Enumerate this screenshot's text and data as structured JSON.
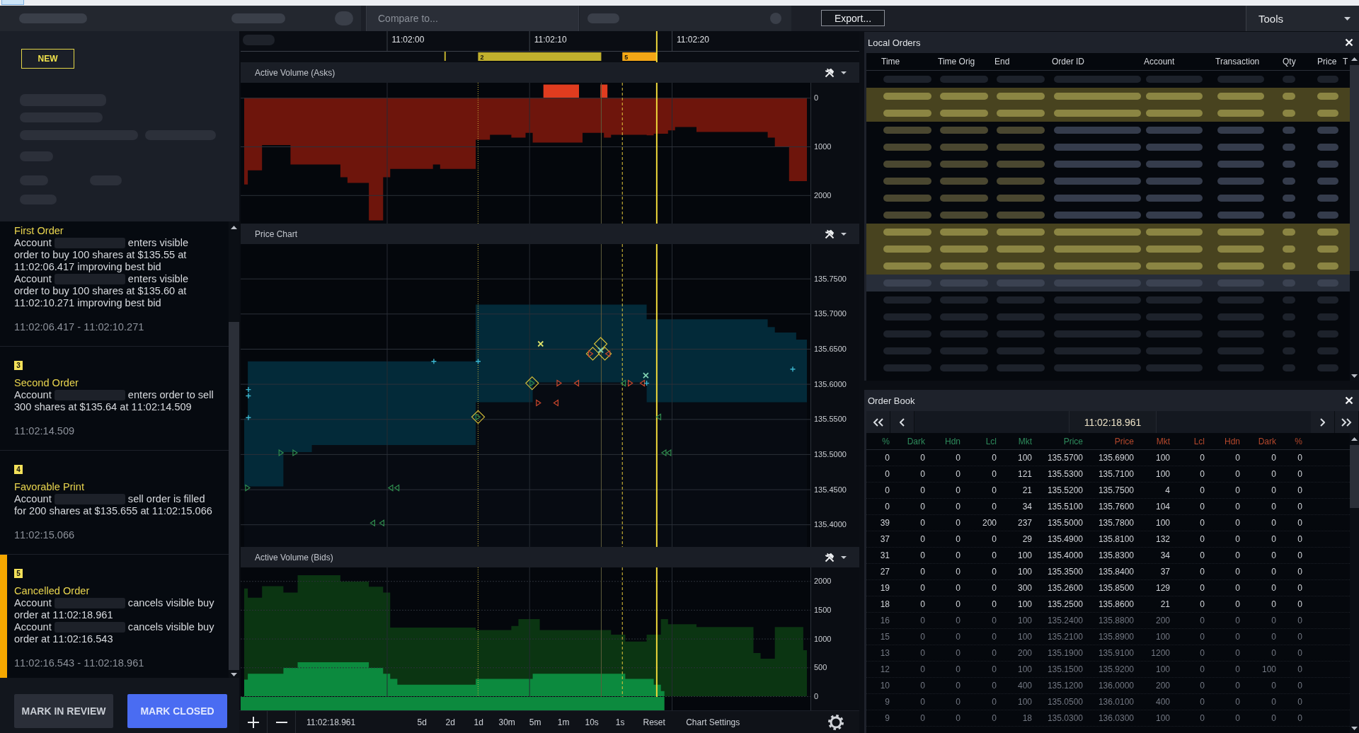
{
  "toolbar": {
    "compare_field": {
      "placeholder": "Compare to..."
    },
    "export_button": "Export...",
    "tools_menu": "Tools"
  },
  "case_panel": {
    "badge": "NEW",
    "events": [
      {
        "title": "First Order",
        "lines": [
          {
            "redacted": true,
            "label": "Account",
            "text": "enters visible order to buy 100 shares at $135.55 at 11:02:06.417 improving best bid"
          },
          {
            "redacted": true,
            "label": "Account",
            "text": "enters visible order to buy 100 shares at $135.60 at 11:02:10.271 improving best bid"
          }
        ],
        "time_range": "11:02:06.417 - 11:02:10.271",
        "selected": false
      },
      {
        "number": "3",
        "title": "Second Order",
        "lines": [
          {
            "redacted": true,
            "label": "Account",
            "text": "enters order to sell 300 shares at $135.64 at 11:02:14.509"
          }
        ],
        "time_range": "11:02:14.509",
        "selected": false
      },
      {
        "number": "4",
        "title": "Favorable Print",
        "lines": [
          {
            "redacted": true,
            "label": "Account",
            "text": "sell order is filled for 200 shares at $135.655 at 11:02:15.066"
          }
        ],
        "time_range": "11:02:15.066",
        "selected": false
      },
      {
        "number": "5",
        "title": "Cancelled Order",
        "lines": [
          {
            "redacted": true,
            "label": "Account",
            "text": "cancels visible buy order at 11:02:18.961"
          },
          {
            "redacted": true,
            "label": "Account",
            "text": "cancels visible buy order at 11:02:16.543"
          }
        ],
        "time_range": "11:02:16.543 - 11:02:18.961",
        "selected": true
      }
    ],
    "actions": [
      {
        "label": "MARK IN REVIEW",
        "kind": "secondary"
      },
      {
        "label": "MARK CLOSED",
        "kind": "primary"
      }
    ]
  },
  "charts": [
    {
      "title": "Active Volume (Asks)",
      "range_markers": [
        {
          "label": "2",
          "color": "#c1b02d"
        },
        {
          "label": "5",
          "color": "#f4a716"
        }
      ],
      "chart_data": {
        "type": "area",
        "grid": true,
        "categories": [
          null,
          null,
          null,
          null,
          null,
          null,
          null,
          null,
          null,
          null,
          null,
          null,
          null,
          null,
          null,
          null,
          null,
          null,
          null,
          null,
          null,
          null,
          null,
          "11:02:00",
          null,
          null,
          null,
          null,
          null,
          null,
          null,
          null,
          null,
          null,
          null,
          null,
          null,
          null,
          null,
          null,
          null,
          null,
          null,
          "11:02:10",
          null,
          null,
          null,
          null,
          null,
          null,
          null,
          null,
          null,
          null,
          null,
          null,
          null,
          null,
          null,
          null,
          null,
          null,
          null,
          "11:02:20",
          null,
          null,
          null,
          null,
          null,
          null,
          null,
          null,
          null,
          null,
          null,
          null,
          null,
          null,
          null,
          null
        ],
        "series": [
          {
            "color": "#6e150c",
            "values": [
              1780,
              1490,
              1490,
              970,
              970,
              970,
              970,
              1370,
              1370,
              1370,
              1370,
              1370,
              1370,
              1370,
              1630,
              1750,
              1750,
              1750,
              2520,
              2520,
              1630,
              1460,
              1460,
              1460,
              1460,
              1460,
              1460,
              1370,
              1460,
              1460,
              1460,
              1460,
              1460,
              860,
              860,
              760,
              760,
              760,
              820,
              820,
              720,
              920,
              920,
              920,
              920,
              920,
              920,
              920,
              720,
              720,
              720,
              820,
              760,
              760,
              760,
              760,
              760,
              770,
              740,
              740,
              670,
              600,
              600,
              600,
              700,
              700,
              700,
              700,
              700,
              700,
              700,
              700,
              700,
              700,
              820,
              1000,
              1000,
              1710,
              1710,
              1710
            ]
          },
          {
            "color": "#e03c1f",
            "values": [
              null,
              null,
              null,
              null,
              null,
              null,
              null,
              null,
              null,
              null,
              null,
              null,
              null,
              null,
              null,
              null,
              null,
              null,
              null,
              null,
              null,
              null,
              null,
              null,
              null,
              null,
              null,
              null,
              null,
              null,
              null,
              null,
              null,
              null,
              null,
              null,
              null,
              null,
              null,
              null,
              null,
              null,
              -270,
              -270,
              -270,
              -270,
              -270,
              -270,
              null,
              null,
              -270,
              -270,
              null,
              null,
              null,
              null,
              null,
              null,
              null,
              null,
              null,
              null,
              null,
              null,
              null,
              null,
              null,
              null,
              null,
              null,
              null,
              null,
              null,
              null,
              null,
              null,
              null,
              null,
              null,
              null
            ]
          }
        ],
        "ylim": [
          2584,
          -308
        ],
        "yticks": [
          0,
          1000,
          2000
        ]
      }
    },
    {
      "title": "Price Chart",
      "chart_data": {
        "type": "area",
        "grid": true,
        "categories": [
          null,
          null,
          null,
          null,
          null,
          null,
          null,
          null,
          null,
          null,
          null,
          null,
          null,
          null,
          null,
          null,
          null,
          null,
          null,
          null,
          null,
          null,
          null,
          null,
          null,
          null,
          null,
          null,
          null,
          null,
          null,
          null,
          null,
          null,
          null,
          null,
          null,
          null,
          null,
          null,
          null,
          null,
          null,
          null,
          null,
          null,
          null,
          null,
          null,
          null,
          null,
          null,
          null,
          null,
          null,
          null,
          null,
          null,
          null,
          null,
          null,
          null,
          null,
          null,
          null,
          null,
          null,
          null,
          null,
          null,
          null,
          null,
          null,
          null,
          null,
          null,
          null,
          null,
          null,
          null
        ],
        "series": [
          {
            "color": "#032a39",
            "values": [
              135.551,
              135.632,
              135.632,
              135.632,
              135.632,
              135.632,
              135.632,
              135.632,
              135.632,
              135.632,
              135.632,
              135.632,
              135.632,
              135.632,
              135.632,
              135.632,
              135.632,
              135.632,
              135.632,
              135.632,
              135.632,
              135.632,
              135.632,
              135.632,
              135.632,
              135.632,
              135.632,
              135.632,
              135.632,
              135.632,
              135.632,
              135.632,
              135.632,
              135.713,
              135.713,
              135.713,
              135.713,
              135.713,
              135.713,
              135.713,
              135.713,
              135.713,
              135.713,
              135.713,
              135.713,
              135.713,
              135.713,
              135.713,
              135.713,
              135.713,
              135.713,
              135.713,
              135.713,
              135.713,
              135.713,
              135.713,
              135.713,
              135.692,
              135.692,
              135.692,
              135.692,
              135.692,
              135.692,
              135.692,
              135.692,
              135.692,
              135.692,
              135.692,
              135.692,
              135.692,
              135.692,
              135.692,
              135.692,
              135.692,
              135.681,
              135.673,
              135.673,
              135.673,
              135.663,
              135.663
            ]
          },
          {
            "color": "#070b12",
            "values": [
              135.454,
              135.454,
              135.454,
              135.454,
              135.454,
              135.454,
              135.503,
              135.503,
              135.503,
              135.503,
              135.513,
              135.513,
              135.513,
              135.513,
              135.513,
              135.513,
              135.513,
              135.513,
              135.513,
              135.513,
              135.513,
              135.513,
              135.513,
              135.513,
              135.513,
              135.513,
              135.513,
              135.513,
              135.513,
              135.513,
              135.513,
              135.513,
              135.513,
              135.574,
              135.574,
              135.574,
              135.574,
              135.574,
              135.574,
              135.574,
              135.574,
              135.602,
              135.602,
              135.602,
              135.602,
              135.602,
              135.602,
              135.602,
              135.602,
              135.602,
              135.602,
              135.602,
              135.602,
              135.602,
              135.602,
              135.602,
              135.602,
              135.574,
              135.574,
              135.574,
              135.574,
              135.574,
              135.574,
              135.574,
              135.574,
              135.574,
              135.574,
              135.574,
              135.574,
              135.574,
              135.574,
              135.574,
              135.574,
              135.574,
              135.574,
              135.574,
              135.574,
              135.574,
              135.574,
              135.574
            ]
          }
        ],
        "ylim": [
          135.368,
          135.799
        ],
        "yticks": [
          {
            "value": 135.4,
            "label": "135.4000"
          },
          {
            "value": 135.45,
            "label": "135.4500"
          },
          {
            "value": 135.5,
            "label": "135.5000"
          },
          {
            "value": 135.55,
            "label": "135.5500"
          },
          {
            "value": 135.6,
            "label": "135.6000"
          },
          {
            "value": 135.65,
            "label": "135.6500"
          },
          {
            "value": 135.7,
            "label": "135.7000"
          },
          {
            "value": 135.75,
            "label": "135.7500"
          }
        ]
      }
    },
    {
      "title": "Active Volume (Bids)",
      "chart_data": {
        "type": "area",
        "grid": true,
        "categories": [
          null,
          null,
          null,
          null,
          null,
          null,
          null,
          null,
          null,
          null,
          null,
          null,
          null,
          null,
          null,
          null,
          null,
          null,
          null,
          null,
          null,
          null,
          null,
          null,
          null,
          null,
          null,
          null,
          null,
          null,
          null,
          null,
          null,
          null,
          null,
          null,
          null,
          null,
          null,
          null,
          null,
          null,
          null,
          null,
          null,
          null,
          null,
          null,
          null,
          null,
          null,
          null,
          null,
          null,
          null,
          null,
          null,
          null,
          null,
          null,
          null,
          null,
          null,
          null,
          null,
          null,
          null,
          null,
          null,
          null,
          null,
          null,
          null,
          null,
          null,
          null,
          null,
          null,
          null,
          null
        ],
        "series": [
          {
            "color": "#0b3512",
            "values": [
              1870,
              1710,
              1710,
              1910,
              1910,
              1910,
              1800,
              1800,
              2100,
              2100,
              2100,
              2100,
              2100,
              2100,
              1990,
              1990,
              1990,
              1990,
              1900,
              1900,
              1800,
              1190,
              1190,
              1190,
              1190,
              1190,
              1190,
              1190,
              1190,
              1190,
              1190,
              1190,
              1190,
              1150,
              1150,
              1150,
              1150,
              1150,
              1220,
              1340,
              1340,
              1340,
              1150,
              1150,
              1150,
              1150,
              1150,
              1150,
              1150,
              1150,
              1150,
              1150,
              1070,
              1070,
              950,
              950,
              950,
              1070,
              1070,
              1340,
              1250,
              1250,
              1250,
              1250,
              1200,
              1200,
              1200,
              1200,
              1200,
              1200,
              1200,
              1200,
              750,
              650,
              650,
              1200,
              1200,
              1200,
              1200,
              800
            ]
          },
          {
            "color": "#0c8a3e",
            "values": [
              290,
              390,
              390,
              390,
              390,
              390,
              490,
              490,
              590,
              590,
              590,
              590,
              590,
              590,
              590,
              590,
              590,
              590,
              490,
              490,
              390,
              300,
              200,
              200,
              200,
              200,
              200,
              200,
              200,
              200,
              200,
              200,
              200,
              300,
              300,
              300,
              300,
              300,
              300,
              300,
              300,
              390,
              390,
              390,
              390,
              390,
              390,
              390,
              390,
              390,
              390,
              390,
              390,
              390,
              300,
              300,
              300,
              300,
              200,
              90,
              null,
              null,
              null,
              null,
              null,
              null,
              null,
              null,
              null,
              null,
              null,
              null,
              null,
              null,
              null,
              null,
              null,
              null,
              null,
              null
            ]
          }
        ],
        "ylim": [
          -246,
          2236
        ],
        "yticks": [
          0,
          500,
          1000,
          1500,
          2000
        ]
      }
    }
  ],
  "chart_toolbar": {
    "time": "11:02:18.961",
    "ranges": [
      "5d",
      "2d",
      "1d",
      "30m",
      "5m",
      "1m",
      "10s",
      "1s"
    ],
    "reset": "Reset",
    "settings": "Chart Settings"
  },
  "local_orders": {
    "title": "Local Orders",
    "columns": [
      "Time",
      "Time Orig",
      "End",
      "Order ID",
      "Account",
      "Transaction",
      "Qty",
      "Price",
      "T"
    ],
    "rows": [
      {
        "highlighted": false,
        "selected": false,
        "dimmed": true
      },
      {
        "highlighted": true,
        "selected": false,
        "dimmed": false
      },
      {
        "highlighted": true,
        "selected": false,
        "dimmed": false
      },
      {
        "highlighted": false,
        "selected": false,
        "dimmed": false
      },
      {
        "highlighted": false,
        "selected": false,
        "dimmed": false
      },
      {
        "highlighted": false,
        "selected": false,
        "dimmed": false
      },
      {
        "highlighted": false,
        "selected": false,
        "dimmed": false
      },
      {
        "highlighted": false,
        "selected": false,
        "dimmed": false
      },
      {
        "highlighted": false,
        "selected": false,
        "dimmed": false
      },
      {
        "highlighted": true,
        "selected": false,
        "dimmed": false
      },
      {
        "highlighted": true,
        "selected": false,
        "dimmed": false
      },
      {
        "highlighted": true,
        "selected": false,
        "dimmed": false
      },
      {
        "highlighted": false,
        "selected": true,
        "dimmed": false
      },
      {
        "highlighted": false,
        "selected": false,
        "dimmed": true
      },
      {
        "highlighted": false,
        "selected": false,
        "dimmed": true
      },
      {
        "highlighted": false,
        "selected": false,
        "dimmed": true
      },
      {
        "highlighted": false,
        "selected": false,
        "dimmed": true
      },
      {
        "highlighted": false,
        "selected": false,
        "dimmed": true
      }
    ]
  },
  "order_book": {
    "title": "Order Book",
    "time": "11:02:18.961",
    "bid_columns": [
      "%",
      "Dark",
      "Hdn",
      "Lcl",
      "Mkt",
      "Price"
    ],
    "ask_columns": [
      "Price",
      "Mkt",
      "Lcl",
      "Hdn",
      "Dark",
      "%"
    ],
    "rows": [
      {
        "cells": [
          "0",
          "0",
          "0",
          "0",
          "100",
          "135.5700",
          "135.6900",
          "100",
          "0",
          "0",
          "0",
          "0"
        ],
        "dimmed": false
      },
      {
        "cells": [
          "0",
          "0",
          "0",
          "0",
          "121",
          "135.5300",
          "135.7100",
          "100",
          "0",
          "0",
          "0",
          "0"
        ],
        "dimmed": false
      },
      {
        "cells": [
          "0",
          "0",
          "0",
          "0",
          "21",
          "135.5200",
          "135.7500",
          "4",
          "0",
          "0",
          "0",
          "0"
        ],
        "dimmed": false
      },
      {
        "cells": [
          "0",
          "0",
          "0",
          "0",
          "34",
          "135.5100",
          "135.7600",
          "104",
          "0",
          "0",
          "0",
          "0"
        ],
        "dimmed": false
      },
      {
        "cells": [
          "39",
          "0",
          "0",
          "200",
          "237",
          "135.5000",
          "135.7800",
          "100",
          "0",
          "0",
          "0",
          "0"
        ],
        "dimmed": false
      },
      {
        "cells": [
          "37",
          "0",
          "0",
          "0",
          "29",
          "135.4900",
          "135.8100",
          "132",
          "0",
          "0",
          "0",
          "0"
        ],
        "dimmed": false
      },
      {
        "cells": [
          "31",
          "0",
          "0",
          "0",
          "100",
          "135.4000",
          "135.8300",
          "34",
          "0",
          "0",
          "0",
          "0"
        ],
        "dimmed": false
      },
      {
        "cells": [
          "27",
          "0",
          "0",
          "0",
          "100",
          "135.3500",
          "135.8400",
          "37",
          "0",
          "0",
          "0",
          "0"
        ],
        "dimmed": false
      },
      {
        "cells": [
          "19",
          "0",
          "0",
          "0",
          "300",
          "135.2600",
          "135.8500",
          "129",
          "0",
          "0",
          "0",
          "0"
        ],
        "dimmed": false
      },
      {
        "cells": [
          "18",
          "0",
          "0",
          "0",
          "100",
          "135.2500",
          "135.8600",
          "21",
          "0",
          "0",
          "0",
          "0"
        ],
        "dimmed": false
      },
      {
        "cells": [
          "16",
          "0",
          "0",
          "0",
          "100",
          "135.2400",
          "135.8800",
          "200",
          "0",
          "0",
          "0",
          "0"
        ],
        "dimmed": true
      },
      {
        "cells": [
          "15",
          "0",
          "0",
          "0",
          "100",
          "135.2100",
          "135.8900",
          "100",
          "0",
          "0",
          "0",
          "0"
        ],
        "dimmed": true
      },
      {
        "cells": [
          "13",
          "0",
          "0",
          "0",
          "200",
          "135.1900",
          "135.9100",
          "1200",
          "0",
          "0",
          "0",
          "0"
        ],
        "dimmed": true
      },
      {
        "cells": [
          "12",
          "0",
          "0",
          "0",
          "100",
          "135.1500",
          "135.9200",
          "100",
          "0",
          "0",
          "100",
          "0"
        ],
        "dimmed": true
      },
      {
        "cells": [
          "10",
          "0",
          "0",
          "0",
          "400",
          "135.1200",
          "136.0000",
          "200",
          "0",
          "0",
          "0",
          "0"
        ],
        "dimmed": true
      },
      {
        "cells": [
          "9",
          "0",
          "0",
          "0",
          "100",
          "135.0500",
          "136.0100",
          "400",
          "0",
          "0",
          "0",
          "0"
        ],
        "dimmed": true
      },
      {
        "cells": [
          "9",
          "0",
          "0",
          "0",
          "18",
          "135.0300",
          "136.0300",
          "100",
          "0",
          "0",
          "0",
          "0"
        ],
        "dimmed": true
      }
    ]
  }
}
